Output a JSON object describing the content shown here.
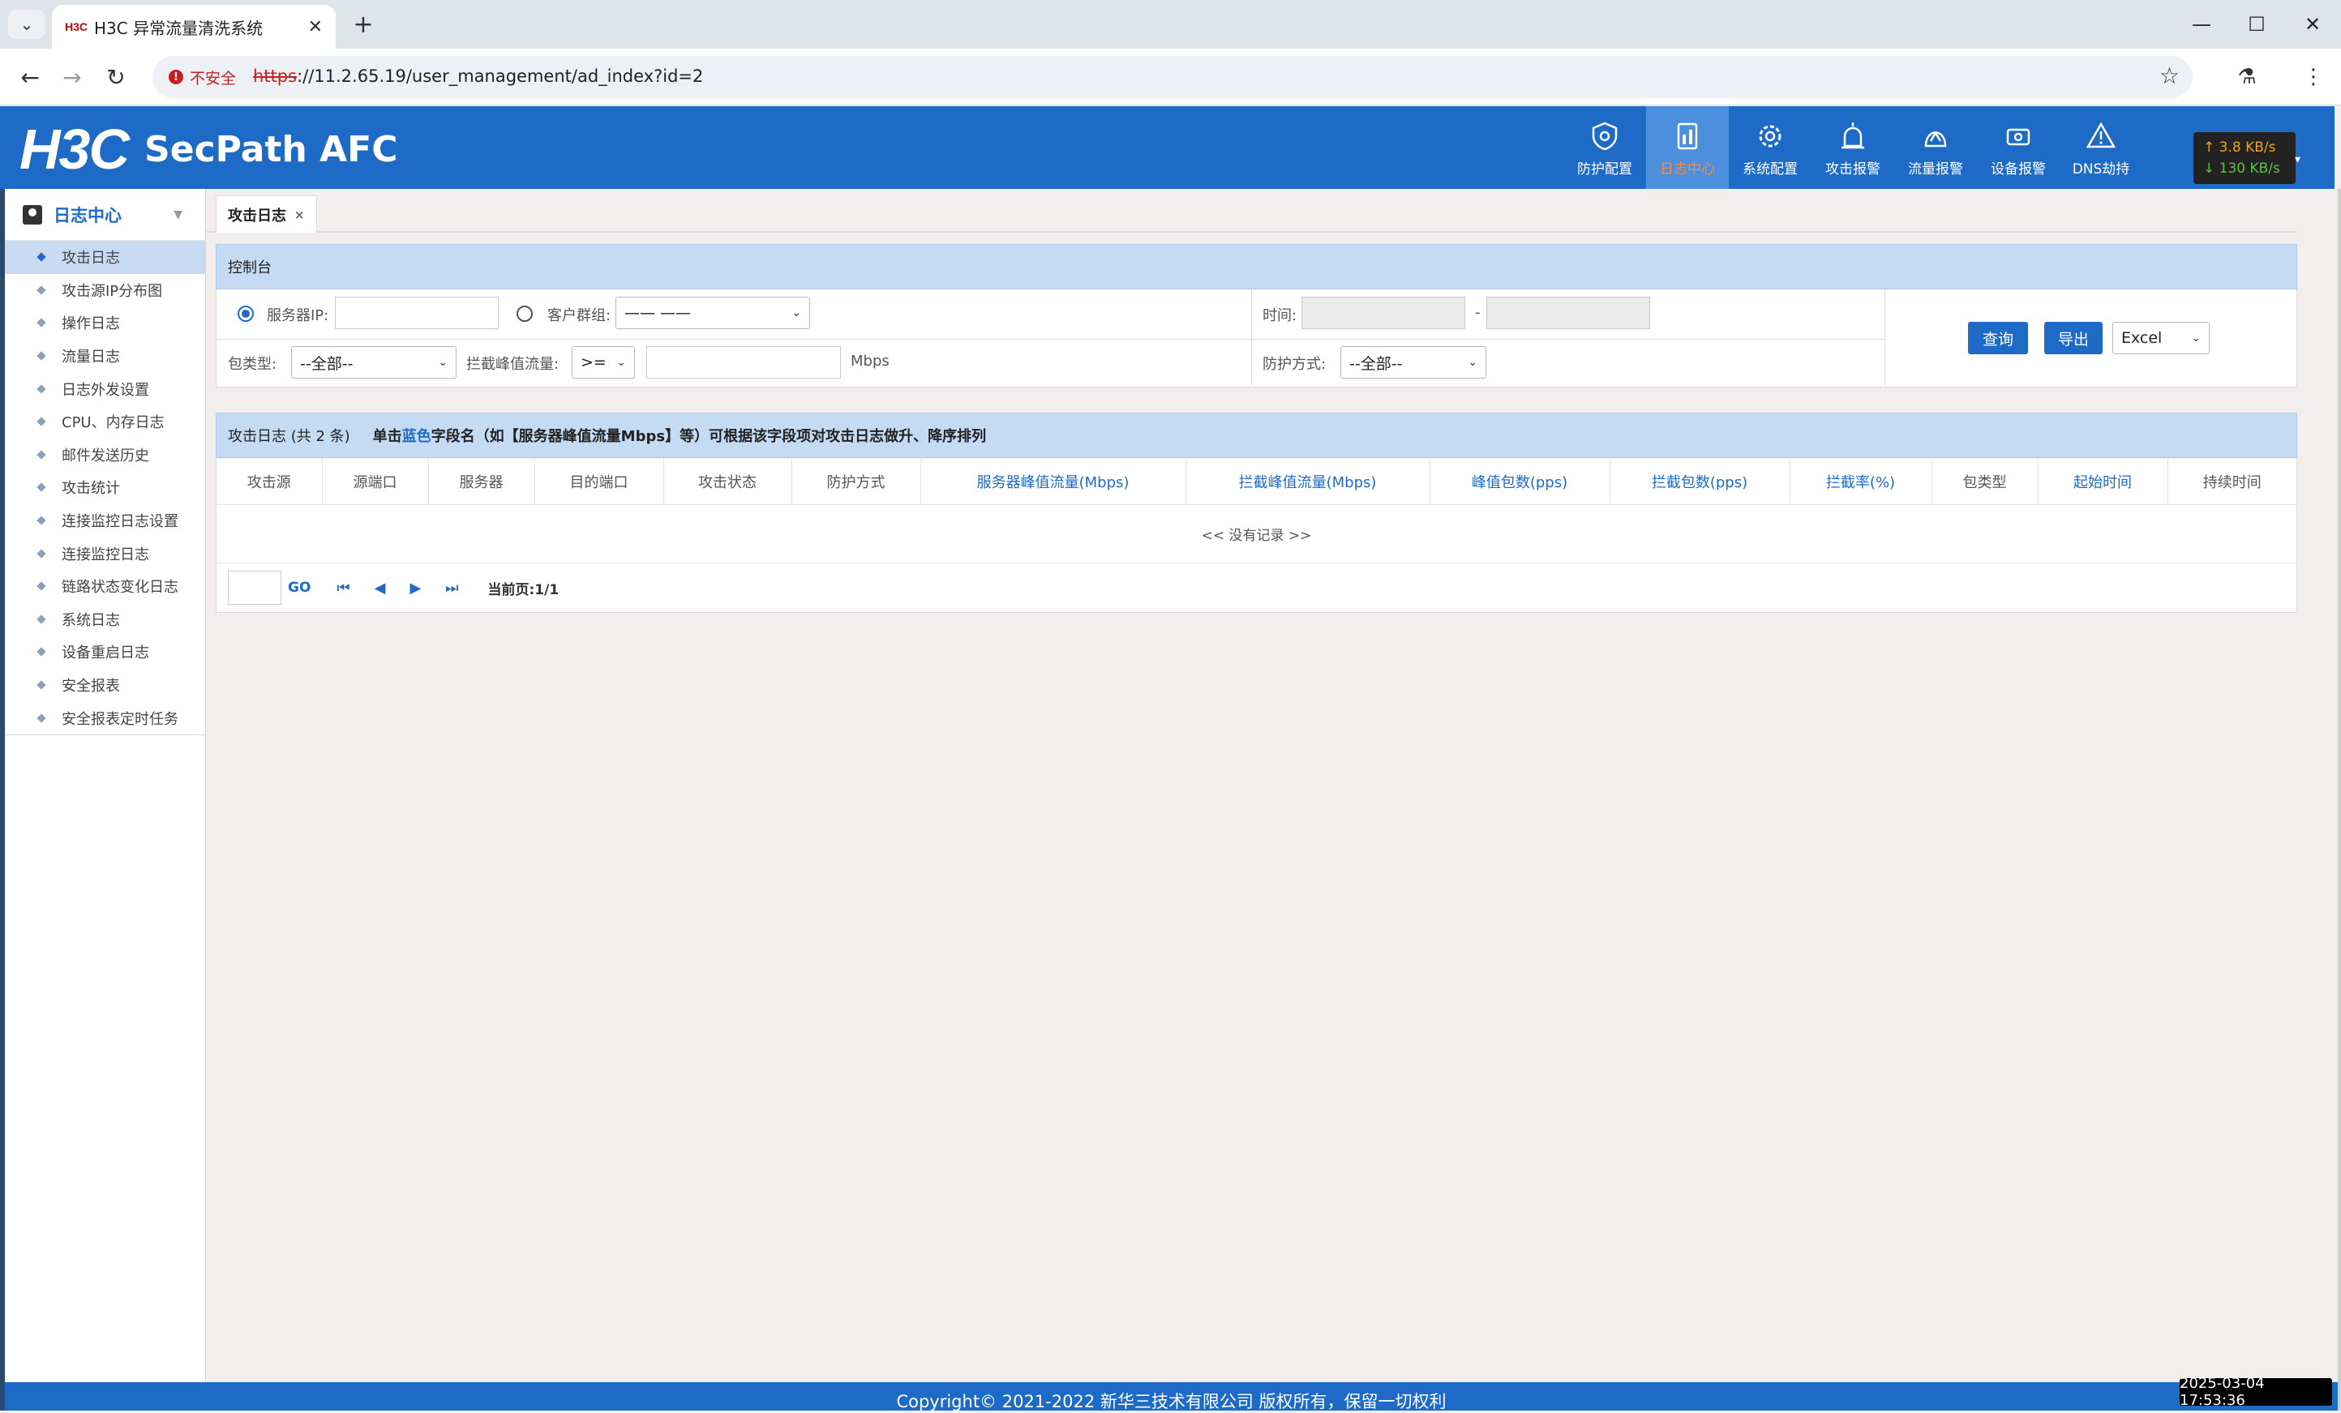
{
  "browser": {
    "tab_title": "H3C 异常流量清洗系统",
    "tab_favicon": "H3C",
    "security_label": "不安全",
    "url_scheme": "https",
    "url_rest": "://11.2.65.19/user_management/ad_index?id=2"
  },
  "app": {
    "logo_brand": "H3C",
    "logo_product": "SecPath AFC",
    "topnav": [
      {
        "label": "防护配置",
        "icon": "shield-icon"
      },
      {
        "label": "日志中心",
        "icon": "log-icon",
        "active": true
      },
      {
        "label": "系统配置",
        "icon": "gear-icon"
      },
      {
        "label": "攻击报警",
        "icon": "alarm-icon"
      },
      {
        "label": "流量报警",
        "icon": "traffic-icon"
      },
      {
        "label": "设备报警",
        "icon": "device-icon"
      },
      {
        "label": "DNS劫持",
        "icon": "warning-icon"
      }
    ],
    "traffic_up": "↑ 3.8 KB/s",
    "traffic_down": "↓ 130 KB/s"
  },
  "sidebar": {
    "title": "日志中心",
    "items": [
      "攻击日志",
      "攻击源IP分布图",
      "操作日志",
      "流量日志",
      "日志外发设置",
      "CPU、内存日志",
      "邮件发送历史",
      "攻击统计",
      "连接监控日志设置",
      "连接监控日志",
      "链路状态变化日志",
      "系统日志",
      "设备重启日志",
      "安全报表",
      "安全报表定时任务"
    ],
    "active_index": 0
  },
  "page_tab": {
    "label": "攻击日志",
    "close": "×"
  },
  "console": {
    "title": "控制台",
    "server_ip_label": "服务器IP:",
    "customer_group_label": "客户群组:",
    "customer_group_value": "—— ——",
    "time_label": "时间:",
    "time_sep": "-",
    "packet_type_label": "包类型:",
    "packet_type_value": "--全部--",
    "block_peak_label": "拦截峰值流量:",
    "operator_value": ">=",
    "unit": "Mbps",
    "protect_mode_label": "防护方式:",
    "protect_mode_value": "--全部--",
    "query_button": "查询",
    "export_button": "导出",
    "export_format": "Excel"
  },
  "log_table": {
    "title": "攻击日志 (共 2 条)",
    "hint_prefix": "单击",
    "hint_blue": "蓝色",
    "hint_suffix": "字段名（如【服务器峰值流量Mbps】等）可根据该字段项对攻击日志做升、降序排列",
    "columns": [
      {
        "label": "攻击源",
        "sortable": false
      },
      {
        "label": "源端口",
        "sortable": false
      },
      {
        "label": "服务器",
        "sortable": false
      },
      {
        "label": "目的端口",
        "sortable": false
      },
      {
        "label": "攻击状态",
        "sortable": false
      },
      {
        "label": "防护方式",
        "sortable": false
      },
      {
        "label": "服务器峰值流量(Mbps)",
        "sortable": true
      },
      {
        "label": "拦截峰值流量(Mbps)",
        "sortable": true
      },
      {
        "label": "峰值包数(pps)",
        "sortable": true
      },
      {
        "label": "拦截包数(pps)",
        "sortable": true
      },
      {
        "label": "拦截率(%)",
        "sortable": true
      },
      {
        "label": "包类型",
        "sortable": false
      },
      {
        "label": "起始时间",
        "sortable": true
      },
      {
        "label": "持续时间",
        "sortable": false
      }
    ],
    "empty_text": "<< 没有记录 >>",
    "pager_go": "GO",
    "current_page": "当前页:1/1"
  },
  "footer": {
    "copyright": "Copyright© 2021-2022 新华三技术有限公司 版权所有，保留一切权利",
    "clock": "2025-03-04 17:53:36"
  }
}
